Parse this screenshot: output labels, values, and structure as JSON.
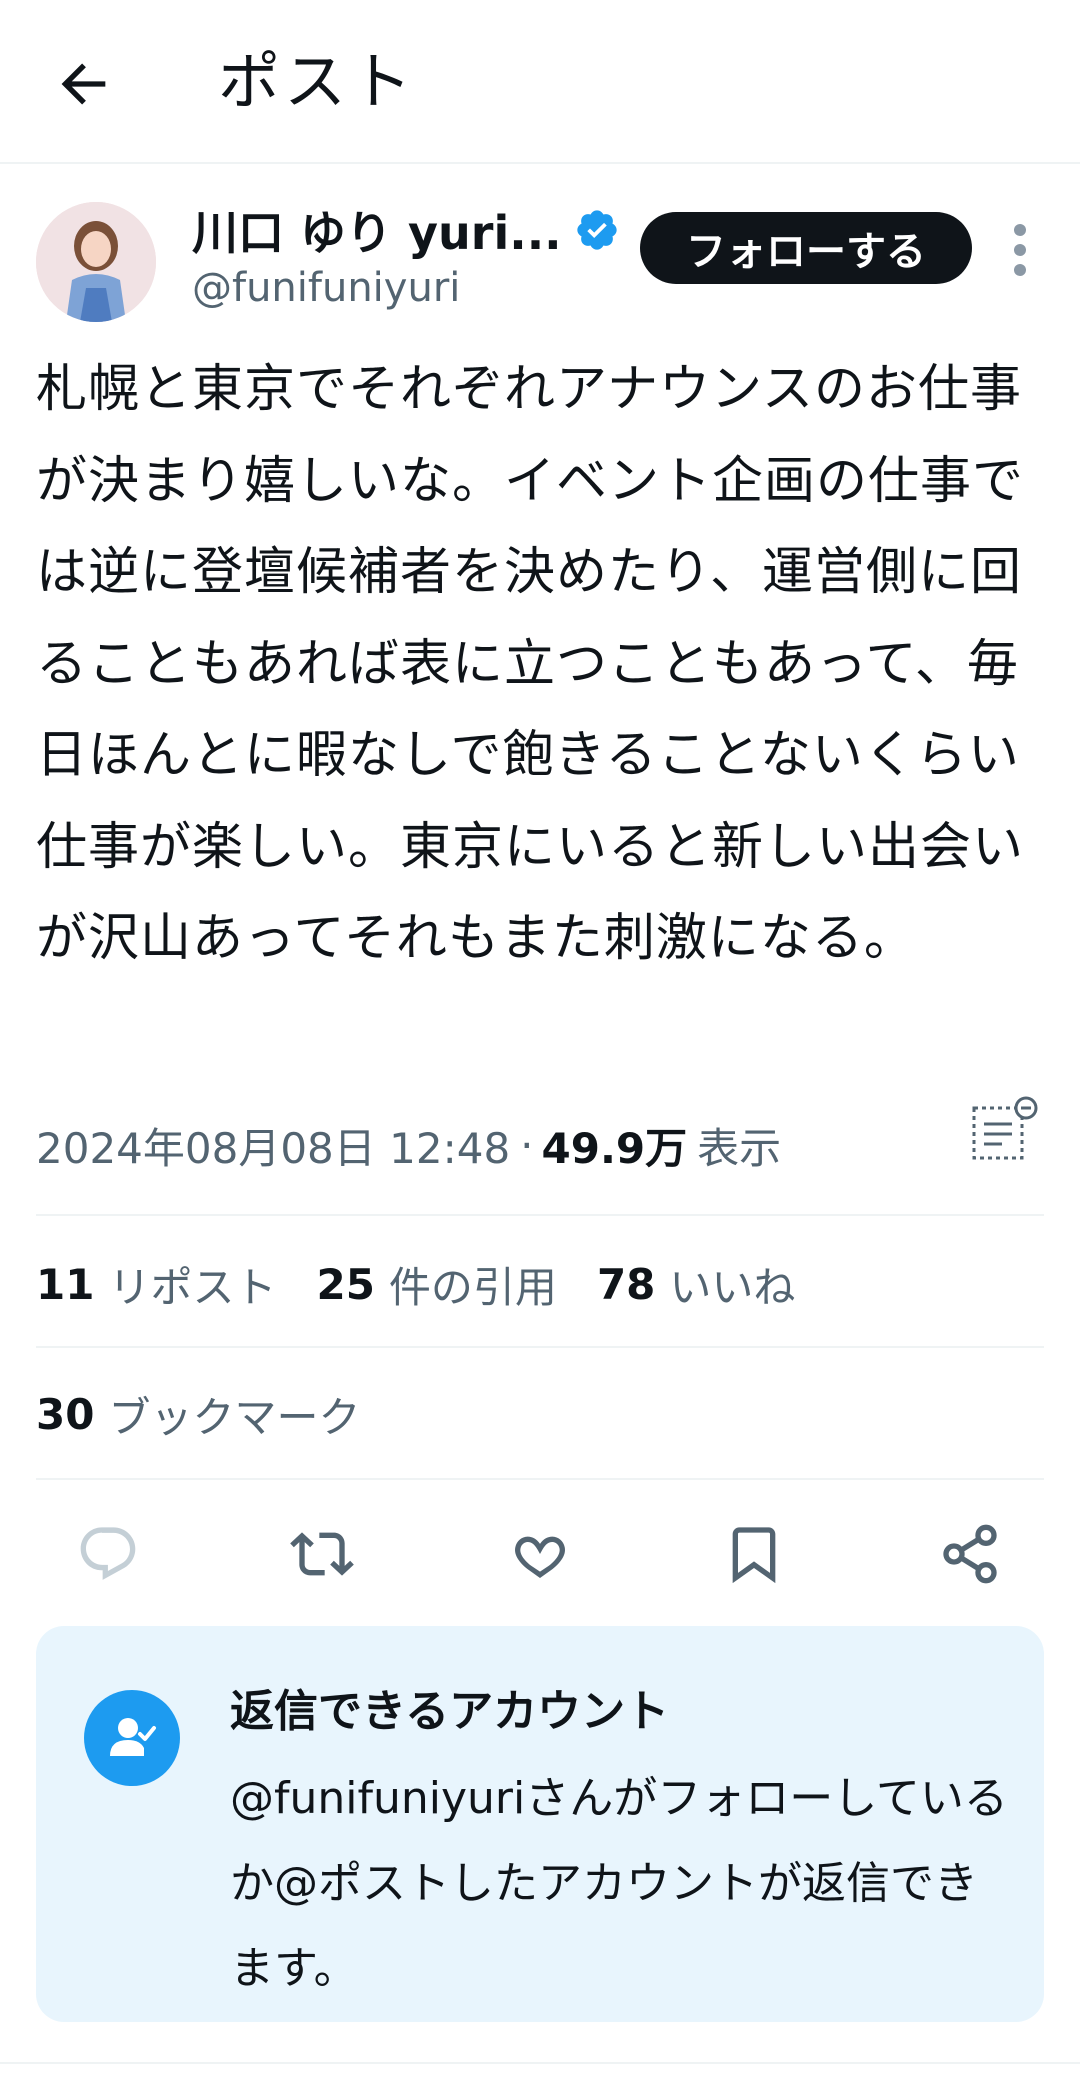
{
  "header": {
    "title": "ポスト",
    "back_icon": "arrow-left-icon"
  },
  "author": {
    "display_name": "川口 ゆり yuri...",
    "handle": "@funifuniyuri",
    "verified": true,
    "follow_label": "フォローする"
  },
  "post": {
    "text": "札幌と東京でそれぞれアナウンスのお仕事が決まり嬉しいな。イベント企画の仕事では逆に登壇候補者を決めたり、運営側に回ることもあれば表に立つこともあって、毎日ほんとに暇なしで飽きることないくらい仕事が楽しい。東京にいると新しい出会いが沢山あってそれもまた刺激になる。",
    "timestamp": "2024年08月08日 12:48",
    "separator": "·",
    "views_count": "49.9万",
    "views_label": "表示"
  },
  "stats": {
    "reposts_count": "11",
    "reposts_label": "リポスト",
    "quotes_count": "25",
    "quotes_label": "件の引用",
    "likes_count": "78",
    "likes_label": "いいね",
    "bookmarks_count": "30",
    "bookmarks_label": "ブックマーク"
  },
  "actions": [
    "reply-icon",
    "repost-icon",
    "like-icon",
    "bookmark-icon",
    "share-icon"
  ],
  "reply_restriction": {
    "title": "返信できるアカウント",
    "body": "@funifuniyuriさんがフォローしているか@ポストしたアカウントが返信できます。"
  },
  "colors": {
    "accent": "#1d9bf0",
    "text_primary": "#0f1419",
    "text_secondary": "#536471",
    "card_background": "#e8f5fd",
    "divider": "#eff3f4"
  }
}
